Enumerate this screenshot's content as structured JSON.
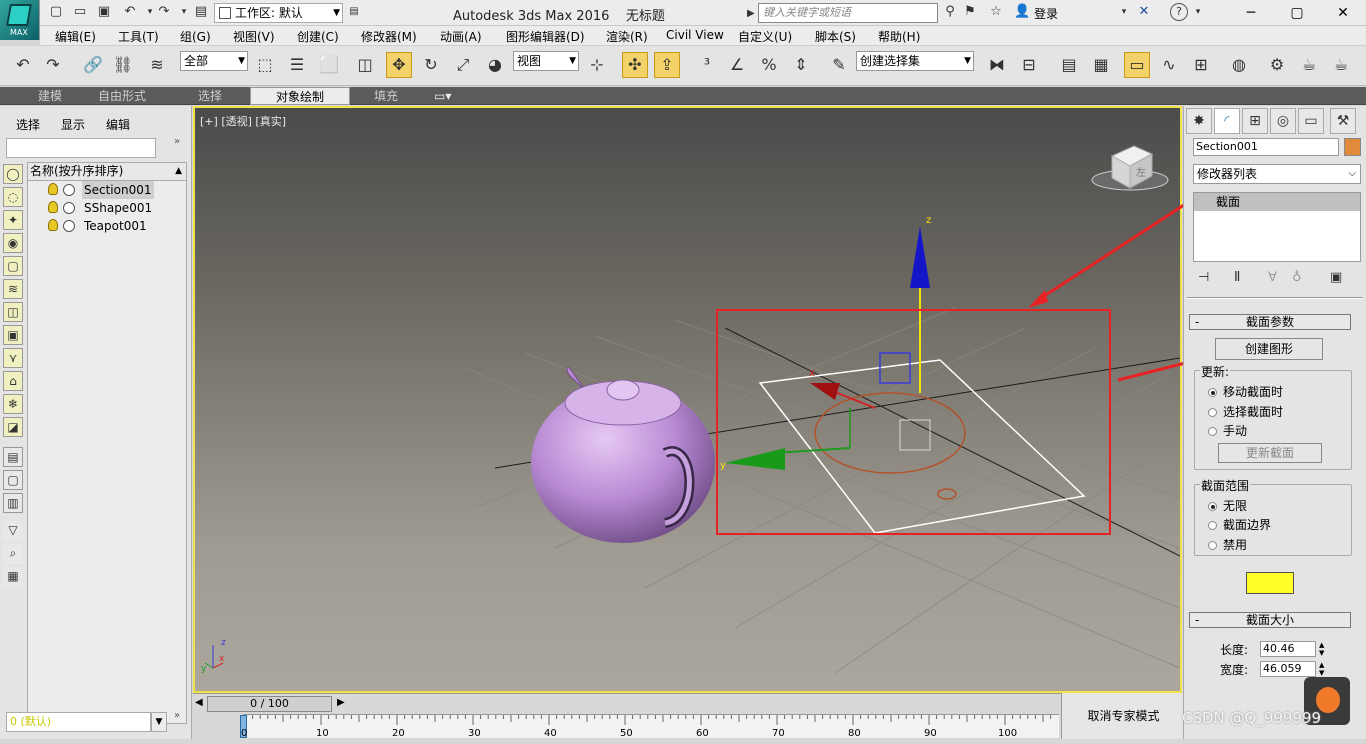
{
  "titlebar": {
    "logo_text": "MAX",
    "workspace": "工作区: 默认",
    "app_title": "Autodesk 3ds Max 2016",
    "doc_title": "无标题",
    "search_placeholder": "键入关键字或短语",
    "login": "登录"
  },
  "menubar": [
    "编辑(E)",
    "工具(T)",
    "组(G)",
    "视图(V)",
    "创建(C)",
    "修改器(M)",
    "动画(A)",
    "图形编辑器(D)",
    "渲染(R)",
    "Civil View",
    "自定义(U)",
    "脚本(S)",
    "帮助(H)"
  ],
  "toolbar": {
    "selection_filter": "全部",
    "ref_coord": "视图",
    "named_selection": "创建选择集"
  },
  "ribbon": {
    "tabs": [
      "建模",
      "自由形式",
      "选择",
      "对象绘制",
      "填充"
    ],
    "active": "对象绘制"
  },
  "scene_explorer": {
    "menus": [
      "选择",
      "显示",
      "编辑"
    ],
    "column_header": "名称(按升序排序)",
    "objects": [
      "Section001",
      "SShape001",
      "Teapot001"
    ],
    "selected": "Section001",
    "layer": "0 (默认)"
  },
  "viewport": {
    "labels": [
      "[+]",
      "[透视]",
      "[真实]"
    ],
    "axis_z": "z",
    "axis_x": "x",
    "axis_y": "y",
    "viewcube_face": "左"
  },
  "timeline": {
    "frame": "0 / 100",
    "ticks": [
      "0",
      "10",
      "20",
      "30",
      "40",
      "50",
      "60",
      "70",
      "80",
      "90",
      "100"
    ]
  },
  "status": {
    "expert_mode": "取消专家模式"
  },
  "command_panel": {
    "object_name": "Section001",
    "object_color": "#e08a3a",
    "modifier_list": "修改器列表",
    "stack_item": "截面",
    "rollout_params": "截面参数",
    "create_shape": "创建图形",
    "update_label": "更新:",
    "update_options": [
      "移动截面时",
      "选择截面时",
      "手动"
    ],
    "update_selected": "移动截面时",
    "update_button": "更新截面",
    "extent_label": "截面范围",
    "extent_options": [
      "无限",
      "截面边界",
      "禁用"
    ],
    "extent_selected": "无限",
    "section_color": "#ffff2a",
    "rollout_size": "截面大小",
    "length_label": "长度:",
    "length_value": "40.46",
    "width_label": "宽度:",
    "width_value": "46.059"
  },
  "watermark": "CSDN @Q_999999"
}
